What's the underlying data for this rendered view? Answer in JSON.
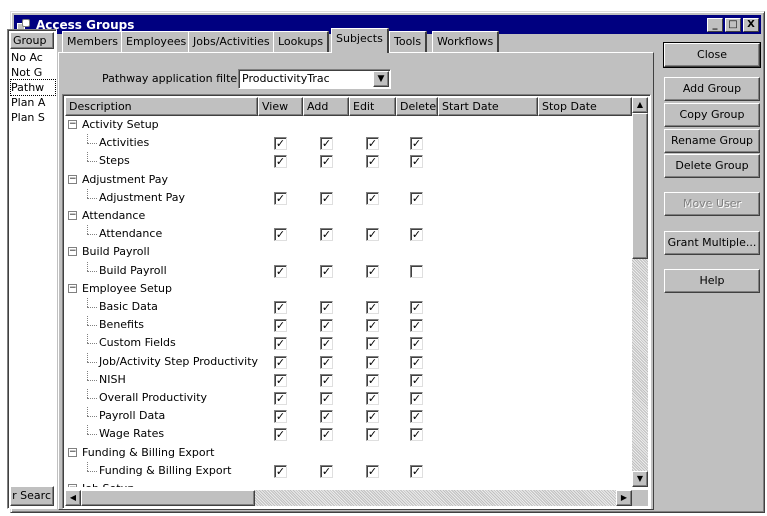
{
  "window": {
    "title": "Access Groups",
    "controls": [
      "_",
      "□",
      "X"
    ]
  },
  "groups": {
    "header": "Group",
    "items": [
      "No Ac",
      "Not G",
      "Pathw",
      "Plan A",
      "Plan S"
    ],
    "search_label": "r Searc"
  },
  "tabs": [
    "Members",
    "Employees",
    "Jobs/Activities",
    "Lookups",
    "Subjects",
    "Tools",
    "Workflows"
  ],
  "active_tab": "Subjects",
  "filter": {
    "label": "Pathway application filter",
    "value": "ProductivityTrac"
  },
  "grid": {
    "columns": [
      "Description",
      "View",
      "Add",
      "Edit",
      "Delete",
      "Start Date",
      "Stop Date"
    ],
    "rows": [
      {
        "label": "Activity Setup",
        "group": true
      },
      {
        "label": "Activities",
        "group": false,
        "checks": [
          true,
          true,
          true,
          true
        ]
      },
      {
        "label": "Steps",
        "group": false,
        "checks": [
          true,
          true,
          true,
          true
        ]
      },
      {
        "label": "Adjustment Pay",
        "group": true
      },
      {
        "label": "Adjustment Pay",
        "group": false,
        "checks": [
          true,
          true,
          true,
          true
        ]
      },
      {
        "label": "Attendance",
        "group": true
      },
      {
        "label": "Attendance",
        "group": false,
        "checks": [
          true,
          true,
          true,
          true
        ]
      },
      {
        "label": "Build Payroll",
        "group": true
      },
      {
        "label": "Build Payroll",
        "group": false,
        "checks": [
          true,
          true,
          true,
          false
        ]
      },
      {
        "label": "Employee Setup",
        "group": true
      },
      {
        "label": "Basic Data",
        "group": false,
        "checks": [
          true,
          true,
          true,
          true
        ]
      },
      {
        "label": "Benefits",
        "group": false,
        "checks": [
          true,
          true,
          true,
          true
        ]
      },
      {
        "label": "Custom Fields",
        "group": false,
        "checks": [
          true,
          true,
          true,
          true
        ]
      },
      {
        "label": "Job/Activity Step Productivity",
        "group": false,
        "checks": [
          true,
          true,
          true,
          true
        ]
      },
      {
        "label": "NISH",
        "group": false,
        "checks": [
          true,
          true,
          true,
          true
        ]
      },
      {
        "label": "Overall Productivity",
        "group": false,
        "checks": [
          true,
          true,
          true,
          true
        ]
      },
      {
        "label": "Payroll Data",
        "group": false,
        "checks": [
          true,
          true,
          true,
          true
        ]
      },
      {
        "label": "Wage Rates",
        "group": false,
        "checks": [
          true,
          true,
          true,
          true
        ]
      },
      {
        "label": "Funding & Billing Export",
        "group": true
      },
      {
        "label": "Funding & Billing Export",
        "group": false,
        "checks": [
          true,
          true,
          true,
          true
        ]
      },
      {
        "label": "Job Setup",
        "group": true
      }
    ]
  },
  "buttons": [
    {
      "label": "Close",
      "enabled": true
    },
    {
      "label": "Add Group",
      "enabled": true
    },
    {
      "label": "Copy Group",
      "enabled": true
    },
    {
      "label": "Rename Group",
      "enabled": true
    },
    {
      "label": "Delete Group",
      "enabled": true
    },
    {
      "label": "Move User",
      "enabled": false
    },
    {
      "label": "Grant Multiple...",
      "enabled": true
    },
    {
      "label": "Help",
      "enabled": true
    }
  ],
  "icons": {
    "expander": "minus-box-icon",
    "check": "checkmark-icon",
    "app": "access-groups-app-icon"
  }
}
